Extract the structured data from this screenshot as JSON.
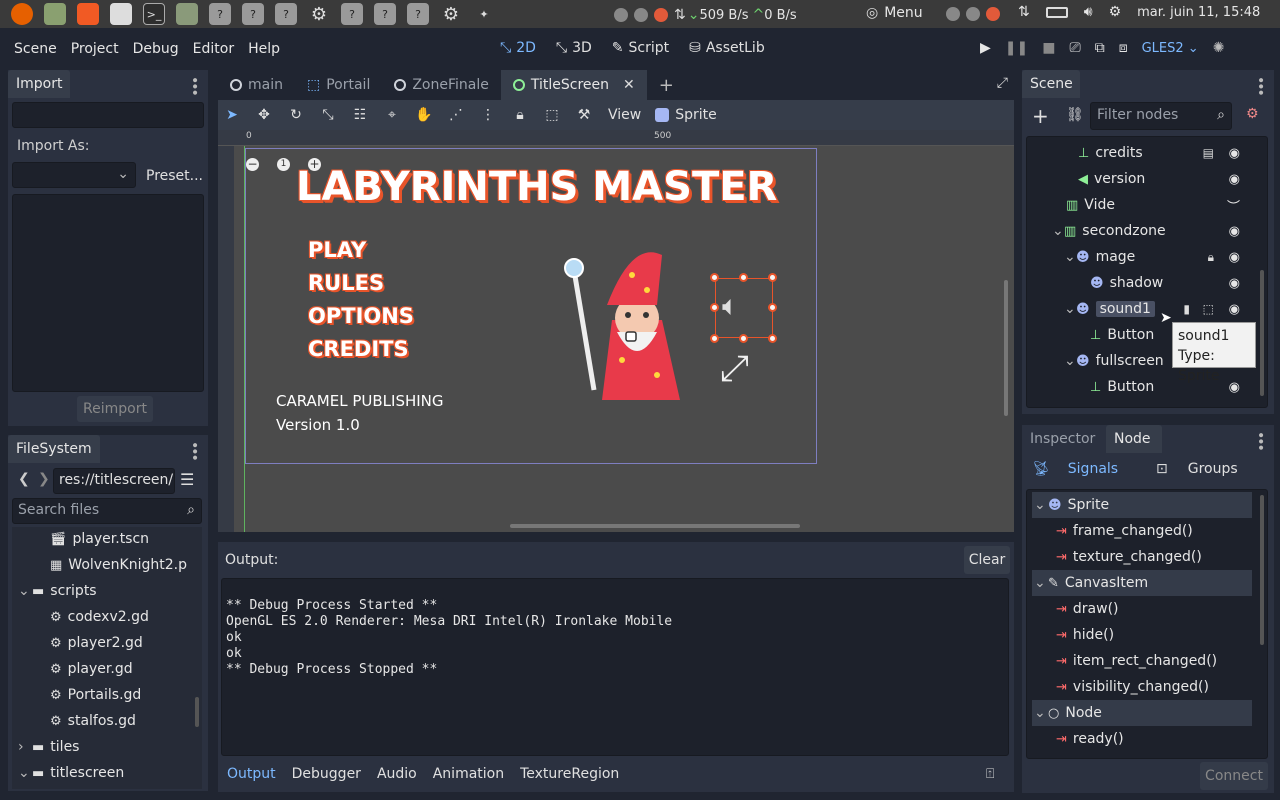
{
  "system_bar": {
    "net_down": "509 B/s",
    "net_up": "0 B/s",
    "menu_label": "Menu",
    "datetime": "mar. juin 11, 15:48"
  },
  "menubar": {
    "items": [
      "Scene",
      "Project",
      "Debug",
      "Editor",
      "Help"
    ],
    "workspaces": [
      "2D",
      "3D",
      "Script",
      "AssetLib"
    ],
    "active_workspace": "2D",
    "renderer": "GLES2"
  },
  "import_dock": {
    "title": "Import",
    "import_as_label": "Import As:",
    "preset_label": "Preset...",
    "reimport_label": "Reimport"
  },
  "filesystem": {
    "title": "FileSystem",
    "path": "res://titlescreen/",
    "search_placeholder": "Search files",
    "items": [
      {
        "label": "player.tscn",
        "icon": "scene-icon",
        "indent": 2
      },
      {
        "label": "WolvenKnight2.p",
        "icon": "image-icon",
        "indent": 2
      },
      {
        "label": "scripts",
        "icon": "folder-icon",
        "indent": 1
      },
      {
        "label": "codexv2.gd",
        "icon": "gear-icon",
        "indent": 2
      },
      {
        "label": "player2.gd",
        "icon": "gear-icon",
        "indent": 2
      },
      {
        "label": "player.gd",
        "icon": "gear-icon",
        "indent": 2
      },
      {
        "label": "Portails.gd",
        "icon": "gear-icon",
        "indent": 2
      },
      {
        "label": "stalfos.gd",
        "icon": "gear-icon",
        "indent": 2
      },
      {
        "label": "tiles",
        "icon": "folder-icon",
        "indent": 1
      },
      {
        "label": "titlescreen",
        "icon": "folder-icon",
        "indent": 1
      }
    ]
  },
  "scene_tabs": [
    {
      "label": "main",
      "active": false
    },
    {
      "label": "Portail",
      "active": false
    },
    {
      "label": "ZoneFinale",
      "active": false
    },
    {
      "label": "TitleScreen",
      "active": true
    }
  ],
  "toolbar": {
    "view_label": "View",
    "sprite_label": "Sprite",
    "ruler_0": "0",
    "ruler_500": "500",
    "zoom_level": "1"
  },
  "game_canvas": {
    "title": "LABYRINTHS MASTER",
    "menu": [
      "PLAY",
      "RULES",
      "OPTIONS",
      "CREDITS"
    ],
    "publisher": "CARAMEL PUBLISHING",
    "version": "Version 1.0"
  },
  "output": {
    "label": "Output:",
    "clear_label": "Clear",
    "lines": [
      "",
      "** Debug Process Started **",
      "OpenGL ES 2.0 Renderer: Mesa DRI Intel(R) Ironlake Mobile",
      "ok",
      "ok",
      "** Debug Process Stopped **"
    ],
    "tabs": [
      "Output",
      "Debugger",
      "Audio",
      "Animation",
      "TextureRegion"
    ]
  },
  "scene_dock": {
    "title": "Scene",
    "filter_placeholder": "Filter nodes",
    "nodes": [
      {
        "label": "credits",
        "icon": "button-icon",
        "indent": 3
      },
      {
        "label": "version",
        "icon": "label-icon",
        "indent": 3
      },
      {
        "label": "Vide",
        "icon": "container-icon",
        "indent": 2
      },
      {
        "label": "secondzone",
        "icon": "container-icon",
        "indent": 2
      },
      {
        "label": "mage",
        "icon": "sprite-icon",
        "indent": 3
      },
      {
        "label": "shadow",
        "icon": "sprite-icon",
        "indent": 4
      },
      {
        "label": "sound1",
        "icon": "sprite-icon",
        "indent": 3
      },
      {
        "label": "Button",
        "icon": "button-icon",
        "indent": 4
      },
      {
        "label": "fullscreen",
        "icon": "sprite-icon",
        "indent": 3
      },
      {
        "label": "Button",
        "icon": "button-icon",
        "indent": 4
      }
    ],
    "tooltip_name": "sound1",
    "tooltip_type": "Type: Sprite"
  },
  "node_dock": {
    "tabs": [
      "Inspector",
      "Node"
    ],
    "signals_label": "Signals",
    "groups_label": "Groups",
    "rows": [
      {
        "label": "Sprite",
        "header": true
      },
      {
        "label": "frame_changed()",
        "header": false
      },
      {
        "label": "texture_changed()",
        "header": false
      },
      {
        "label": "CanvasItem",
        "header": true
      },
      {
        "label": "draw()",
        "header": false
      },
      {
        "label": "hide()",
        "header": false
      },
      {
        "label": "item_rect_changed()",
        "header": false
      },
      {
        "label": "visibility_changed()",
        "header": false
      },
      {
        "label": "Node",
        "header": true
      },
      {
        "label": "ready()",
        "header": false
      }
    ],
    "connect_label": "Connect"
  },
  "colors": {
    "accent": "#7db9ff",
    "signal": "#ff6b6b",
    "game_title_fill": "#ffffff",
    "game_title_outline": "#e8542a"
  }
}
